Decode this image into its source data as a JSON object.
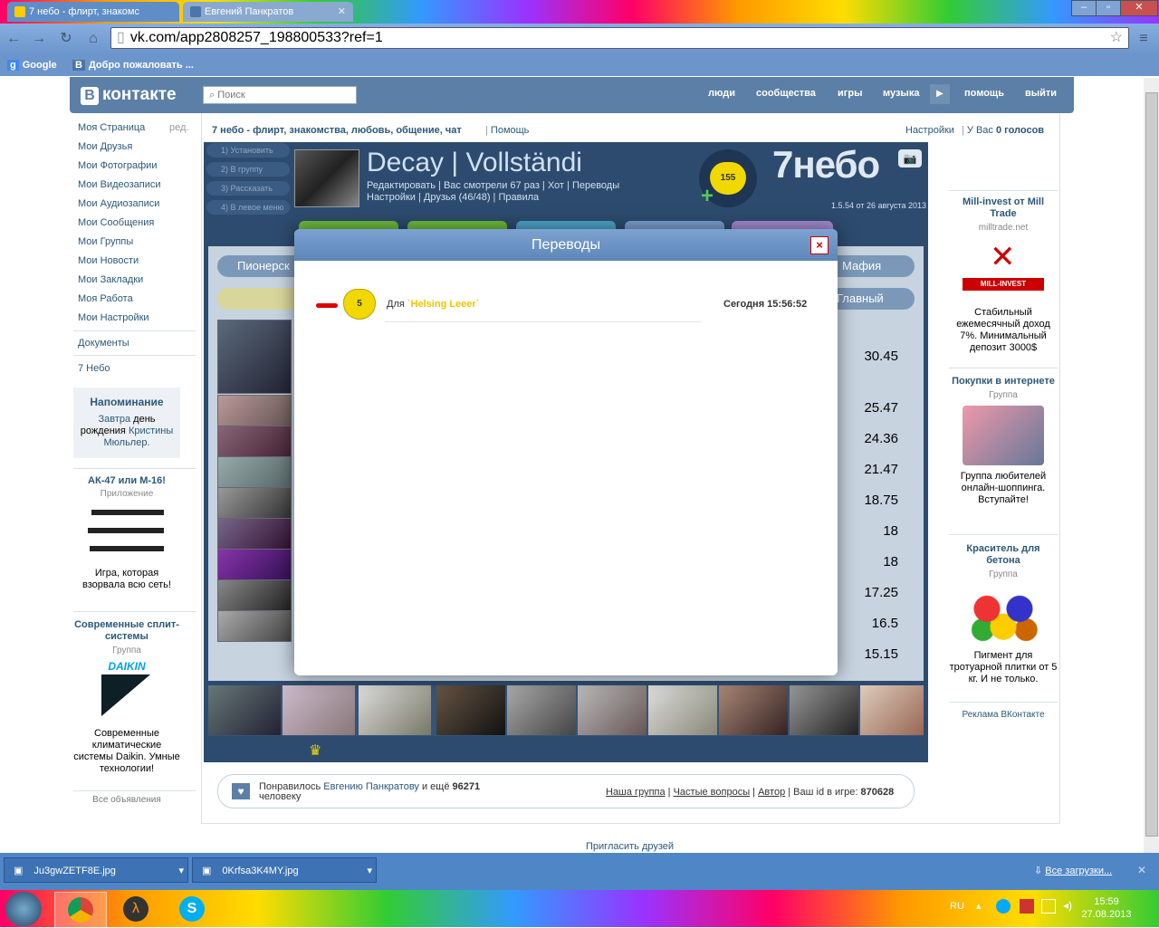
{
  "browser": {
    "tabs": [
      {
        "title": "7 небо - флирт, знакомс"
      },
      {
        "title": "Евгений Панкратов"
      }
    ],
    "url": "vk.com/app2808257_198800533?ref=1",
    "bookmarks": [
      "Google",
      "Добро пожаловать ..."
    ]
  },
  "vk": {
    "logo": "контакте",
    "logo_letter": "B",
    "search_placeholder": "Поиск",
    "top_nav": [
      "люди",
      "сообщества",
      "игры",
      "музыка",
      "помощь",
      "выйти"
    ],
    "left_menu": [
      "Моя Страница",
      "Мои Друзья",
      "Мои Фотографии",
      "Мои Видеозаписи",
      "Мои Аудиозаписи",
      "Мои Сообщения",
      "Мои Группы",
      "Мои Новости",
      "Мои Закладки",
      "Моя Работа",
      "Мои Настройки"
    ],
    "edit_label": "ред.",
    "documents": "Документы",
    "app_link": "7 Небо",
    "reminder": {
      "title": "Напоминание",
      "text1": "Завтра",
      "text2": " день рождения ",
      "text3": "Кристины Мюльлер."
    },
    "left_ads": [
      {
        "title": "АК-47 или М-16!",
        "sub": "Приложение",
        "text": "Игра, которая взорвала всю сеть!"
      },
      {
        "title": "Современные сплит-системы",
        "sub": "Группа",
        "text": "Современные климатические системы Daikin. Умные технологии!",
        "brand": "DAIKIN"
      }
    ],
    "all_ads": "Все объявления",
    "app_title": "7 небо - флирт, знакомства, любовь, общение, чат",
    "help": "Помощь",
    "settings": "Настройки",
    "votes_prefix": "У Вас ",
    "votes_count": "0 голосов",
    "right_ads": [
      {
        "title": "Mill-invest от Mill Trade",
        "sub": "milltrade.net",
        "text": "Стабильный ежемесячный доход 7%. Минимальный депозит 3000$",
        "brand": "MILL-INVEST"
      },
      {
        "title": "Покупки в интернете",
        "sub": "Группа",
        "text": "Группа любителей онлайн-шоппинга. Вступайте!"
      },
      {
        "title": "Краситель для бетона",
        "sub": "Группа",
        "text": "Пигмент для тротуарной плитки от 5 кг. И не только."
      }
    ],
    "vk_ads": "Реклама ВКонтакте",
    "invite": "Пригласить друзей"
  },
  "app": {
    "left_buttons": [
      "1) Установить",
      "2) В группу",
      "3) Рассказать",
      "4) В левое меню"
    ],
    "profile_name": "Decay | Vollständi",
    "profile_links1": "Редактировать | Вас смотрели 67 раз | Хот | Переводы",
    "profile_links2": "Настройки | Друзья (46/48) | Правила",
    "heart_count": "155",
    "brand": "7небо",
    "version": "1.5.54 от 26 августа 2013",
    "tabs_left": "Пионерск",
    "tab_right1": "Мафия",
    "tab_right2": "Главный",
    "scores": [
      "30.45",
      "25.47",
      "24.36",
      "21.47",
      "18.75",
      "18",
      "18",
      "17.25",
      "16.5",
      "15.15"
    ]
  },
  "modal": {
    "title": "Переводы",
    "close": "×",
    "row": {
      "heart_value": "5",
      "for_label": "Для ",
      "recipient": "`Helsing Leeer`",
      "time": "Сегодня 15:56:52"
    }
  },
  "likebar": {
    "text_prefix": "Понравилось ",
    "liker": "Евгению Панкратову",
    "text_middle": " и ещё ",
    "count": "96271",
    "text_suffix": "человеку",
    "links": [
      "Наша группа",
      "Частые вопросы",
      "Автор"
    ],
    "id_label": "Ваш id в игре: ",
    "id_value": "870628"
  },
  "downloads": {
    "files": [
      "Ju3gwZETF8E.jpg",
      "0Krfsa3K4MY.jpg"
    ],
    "all": "Все загрузки..."
  },
  "taskbar": {
    "lang": "RU",
    "time": "15:59",
    "date": "27.08.2013"
  }
}
